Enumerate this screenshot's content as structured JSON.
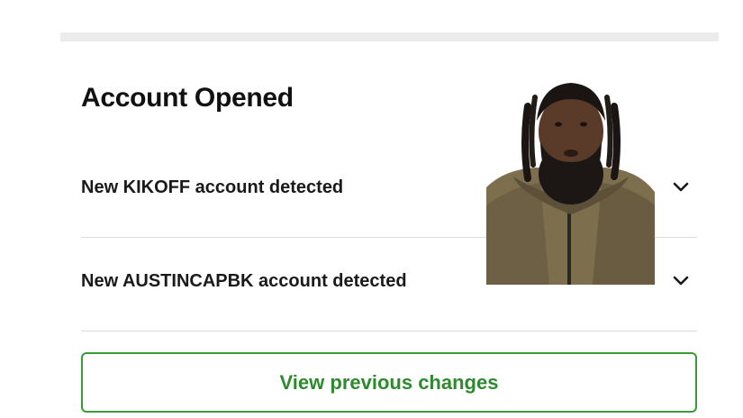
{
  "section": {
    "title": "Account Opened"
  },
  "alerts": [
    {
      "label": "New KIKOFF account detected",
      "icon": "chevron-down-icon"
    },
    {
      "label": "New AUSTINCAPBK account detected",
      "icon": "chevron-down-icon"
    }
  ],
  "actions": {
    "view_previous_label": "View previous changes"
  },
  "colors": {
    "accent_green": "#3a9a3a",
    "divider": "#dcdcdc",
    "top_band": "#ececec"
  }
}
